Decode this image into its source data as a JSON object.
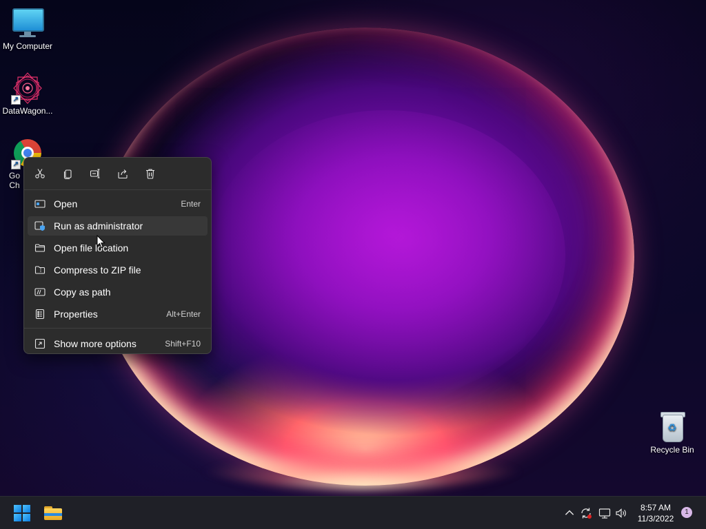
{
  "desktop": {
    "icons": [
      {
        "label": "My Computer",
        "icon": "monitor-icon"
      },
      {
        "label": "DataWagon...",
        "icon": "datawagon-icon"
      },
      {
        "label": "Go Ch",
        "icon": "chrome-icon"
      },
      {
        "label": "Recycle Bin",
        "icon": "recycle-bin-icon"
      }
    ]
  },
  "context_menu": {
    "toolbar": [
      {
        "name": "cut",
        "icon": "scissors-icon"
      },
      {
        "name": "copy",
        "icon": "copy-icon"
      },
      {
        "name": "rename",
        "icon": "rename-icon"
      },
      {
        "name": "share",
        "icon": "share-icon"
      },
      {
        "name": "delete",
        "icon": "trash-icon"
      }
    ],
    "items": [
      {
        "label": "Open",
        "shortcut": "Enter",
        "icon": "open-icon"
      },
      {
        "label": "Run as administrator",
        "shortcut": "",
        "icon": "admin-shield-icon"
      },
      {
        "label": "Open file location",
        "shortcut": "",
        "icon": "folder-icon"
      },
      {
        "label": "Compress to ZIP file",
        "shortcut": "",
        "icon": "zip-icon"
      },
      {
        "label": "Copy as path",
        "shortcut": "",
        "icon": "path-icon"
      },
      {
        "label": "Properties",
        "shortcut": "Alt+Enter",
        "icon": "properties-icon"
      },
      {
        "label": "Show more options",
        "shortcut": "Shift+F10",
        "icon": "more-options-icon"
      }
    ],
    "hovered_item": "Run as administrator"
  },
  "taskbar": {
    "pinned": [
      {
        "name": "start",
        "icon": "windows-logo-icon"
      },
      {
        "name": "file-explorer",
        "icon": "file-explorer-icon"
      }
    ],
    "tray": {
      "icons": [
        "chevron-up-icon",
        "sync-icon",
        "network-icon",
        "volume-icon"
      ],
      "time": "8:57 AM",
      "date": "11/3/2022",
      "notification_count": "1"
    }
  },
  "colors": {
    "menu_bg": "#2c2c2c",
    "menu_hover": "#383838",
    "taskbar_bg": "#1f2027",
    "accent": "#0a7be0"
  }
}
